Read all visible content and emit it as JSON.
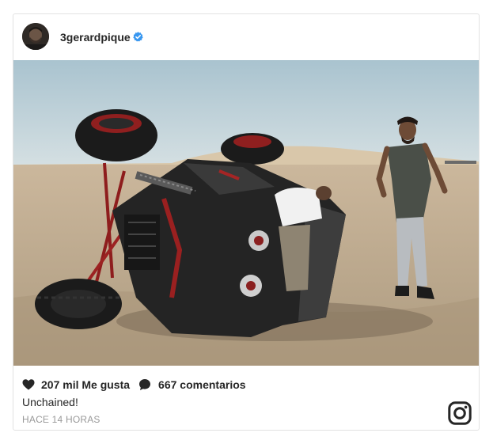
{
  "post": {
    "username": "3gerardpique",
    "verified_icon": "verified-badge-icon",
    "photo_icon": "post-photo",
    "likes_icon": "heart-icon",
    "likes_text": "207 mil Me gusta",
    "comments_icon": "comment-bubble-icon",
    "comments_text": "667 comentarios",
    "caption": "Unchained!",
    "timestamp": "HACE 14 HORAS",
    "platform_icon": "instagram-icon"
  },
  "colors": {
    "text": "#262626",
    "muted": "#999999",
    "verified": "#3897f0",
    "border": "#e2e2e2"
  }
}
